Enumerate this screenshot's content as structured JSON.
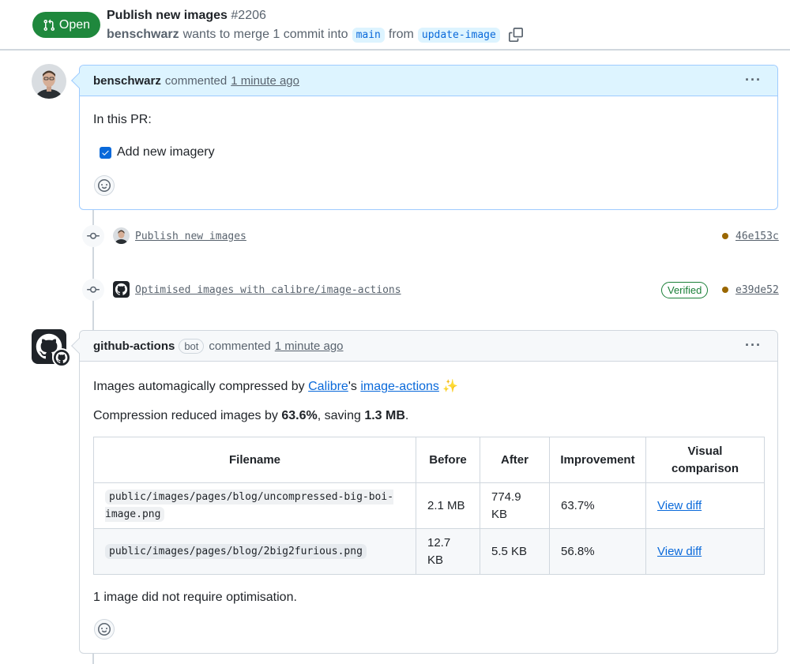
{
  "pr": {
    "state": "Open",
    "title": "Publish new images",
    "number": "#2206",
    "author": "benschwarz",
    "merge_text": "wants to merge 1 commit into",
    "base_branch": "main",
    "from_text": "from",
    "head_branch": "update-image"
  },
  "comment1": {
    "author": "benschwarz",
    "action": "commented",
    "timestamp": "1 minute ago",
    "body_intro": "In this PR:",
    "task_label": "Add new imagery",
    "task_checked": true
  },
  "commits": [
    {
      "message": "Publish new images",
      "sha": "46e153c",
      "verified": ""
    },
    {
      "message": "Optimised images with calibre/image-actions",
      "sha": "e39de52",
      "verified": "Verified"
    }
  ],
  "comment2": {
    "author": "github-actions",
    "badge": "bot",
    "action": "commented",
    "timestamp": "1 minute ago",
    "line1_prefix": "Images automagically compressed by ",
    "link_calibre": "Calibre",
    "line1_mid": "'s ",
    "link_actions": "image-actions",
    "sparkle": "✨",
    "line2_prefix": "Compression reduced images by ",
    "line2_pct": "63.6%",
    "line2_mid": ", saving ",
    "line2_size": "1.3 MB",
    "line2_end": ".",
    "footer": "1 image did not require optimisation."
  },
  "table": {
    "headers": [
      "Filename",
      "Before",
      "After",
      "Improvement",
      "Visual comparison"
    ],
    "rows": [
      {
        "filename": "public/images/pages/blog/uncompressed-big-boi-image.png",
        "before": "2.1 MB",
        "after": "774.9 KB",
        "improvement": "63.7%",
        "link": "View diff"
      },
      {
        "filename": "public/images/pages/blog/2big2furious.png",
        "before": "12.7 KB",
        "after": "5.5 KB",
        "improvement": "56.8%",
        "link": "View diff"
      }
    ]
  },
  "colors": {
    "open_green": "#1f883d",
    "link_blue": "#0969da",
    "header_blue_bg": "#ddf4ff",
    "verified_green": "#1a7f37",
    "commit_dot": "#9a6700"
  },
  "icons": [
    "git-pull-request-icon",
    "copy-icon",
    "kebab-icon",
    "git-commit-icon",
    "smiley-icon",
    "github-mark-icon"
  ]
}
